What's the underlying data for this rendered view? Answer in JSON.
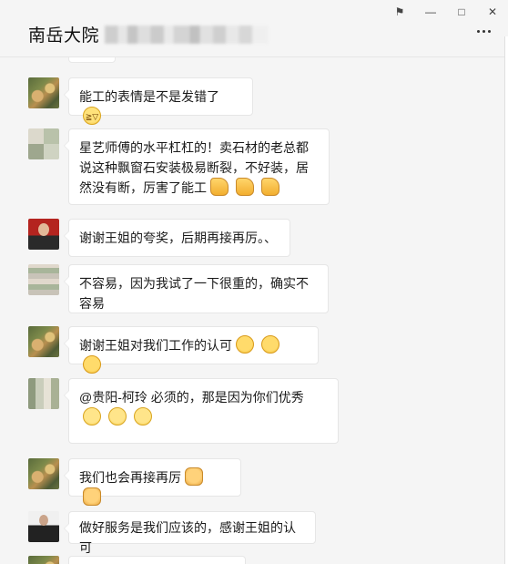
{
  "window": {
    "controls": {
      "pin": "⚑",
      "minimize": "—",
      "maximize": "□",
      "close": "✕"
    },
    "icons": [
      "pin-icon",
      "minimize-icon",
      "maximize-icon",
      "close-icon",
      "more-icon"
    ]
  },
  "header": {
    "title": "南岳大院"
  },
  "messages": [
    {
      "avatar": "dragon",
      "text": "能工的表情是不是发错了",
      "emojis": [
        "laugh-cry"
      ]
    },
    {
      "avatar": "mosaic",
      "text": "星艺师傅的水平杠杠的！卖石材的老总都说这种飘窗石安装极易断裂，不好装，居然没有断，厉害了能工",
      "emojis": [
        "thumbs-up",
        "thumbs-up",
        "thumbs-up"
      ]
    },
    {
      "avatar": "man-red",
      "text": "谢谢王姐的夸奖，后期再接再厉。、",
      "emojis": []
    },
    {
      "avatar": "mosaic",
      "text": "不容易，因为我试了一下很重的，确实不容易",
      "emojis": []
    },
    {
      "avatar": "dragon",
      "text": "谢谢王姐对我们工作的认可",
      "emojis": [
        "hug",
        "hug",
        "hug"
      ]
    },
    {
      "avatar": "mosaic",
      "text": "@贵阳-柯玲 必须的，那是因为你们优秀",
      "emojis": [
        "smile",
        "smile",
        "smile"
      ]
    },
    {
      "avatar": "dragon",
      "text": "我们也会再接再厉",
      "emojis": [
        "fist",
        "fist"
      ]
    },
    {
      "avatar": "suit",
      "text": "做好服务是我们应该的，感谢王姐的认可",
      "emojis": []
    }
  ]
}
